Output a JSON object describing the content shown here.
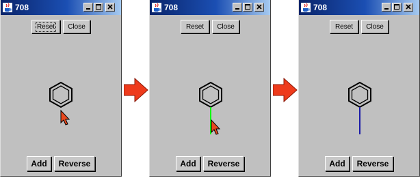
{
  "windows": [
    {
      "title": "708",
      "reset_label": "Reset",
      "close_label": "Close",
      "add_label": "Add",
      "reverse_label": "Reverse",
      "bond": "none",
      "cursor_visible": true,
      "reset_focused": true
    },
    {
      "title": "708",
      "reset_label": "Reset",
      "close_label": "Close",
      "add_label": "Add",
      "reverse_label": "Reverse",
      "bond": "green",
      "cursor_visible": true,
      "reset_focused": false
    },
    {
      "title": "708",
      "reset_label": "Reset",
      "close_label": "Close",
      "add_label": "Add",
      "reverse_label": "Reverse",
      "bond": "blue",
      "cursor_visible": false,
      "reset_focused": false
    }
  ],
  "colors": {
    "titlebar_start": "#0a246a",
    "titlebar_end": "#a6caf0",
    "window_bg": "#c0c0c0",
    "arrow": "#ee3b1c",
    "bond_green": "#00ff00",
    "bond_blue": "#1a1aa8",
    "cursor": "#e8481e"
  },
  "icons": {
    "window_icon": "java-cup-icon",
    "step_arrow": "arrow-right-icon",
    "pointer": "mouse-pointer-icon",
    "structure": "benzene-ring-icon"
  }
}
